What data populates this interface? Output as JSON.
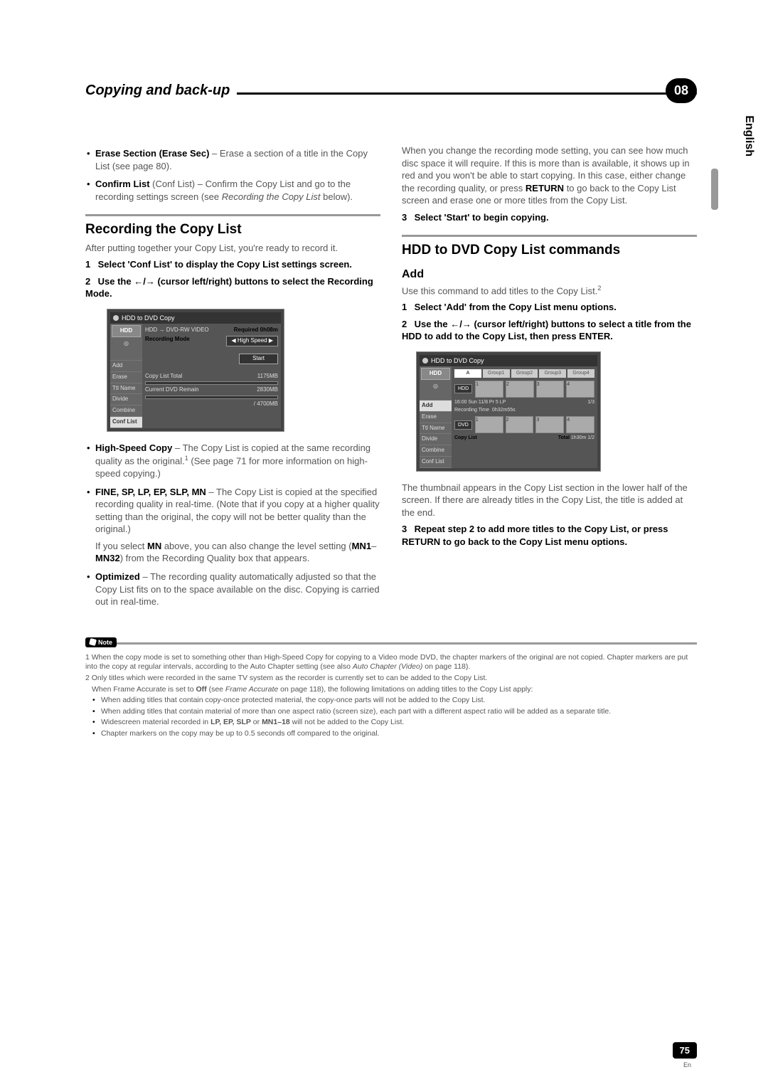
{
  "header": {
    "title": "Copying and back-up",
    "chapter": "08"
  },
  "language": "English",
  "left": {
    "b1_strong": "Erase Section (Erase Sec)",
    "b1_rest": " – Erase a section of a title in the Copy List (see page 80).",
    "b2_strong": "Confirm List",
    "b2_paren": " (Conf List)",
    "b2_rest": " – Confirm the Copy List and go to the recording settings screen (see ",
    "b2_italic": "Recording the Copy List",
    "b2_tail": " below).",
    "h1": "Recording the Copy List",
    "intro": "After putting together your Copy List, you're ready to record it.",
    "step1": "Select 'Conf List' to display the Copy List settings screen.",
    "step2_a": "Use the ",
    "step2_arrows": "←/→",
    "step2_b": " (cursor left/right) buttons to select the Recording Mode.",
    "ss1": {
      "title": "HDD to DVD Copy",
      "hdd_label": "HDD",
      "dest": "HDD → DVD-RW  VIDEO",
      "required": "Required 0h08m",
      "rec_mode_lbl": "Recording Mode",
      "rec_mode_val": "High Speed",
      "start": "Start",
      "copy_total_lbl": "Copy List Total",
      "copy_total_val": "1175MB",
      "remain_lbl": "Current DVD Remain",
      "remain_val": "2830MB",
      "capacity": "/ 4700MB",
      "side": [
        "Add",
        "Erase",
        "Ttl Name",
        "Divide",
        "Combine",
        "Conf List"
      ],
      "side_sel_idx": 5
    },
    "hs_strong": "High-Speed Copy",
    "hs_rest": " – The Copy List is copied at the same recording quality as the original.",
    "hs_fn": "1",
    "hs_tail": " (See page 71 for more information on high-speed copying.)",
    "modes_strong": "FINE, SP, LP, EP, SLP, MN",
    "modes_rest": " – The Copy List is copied at the specified recording quality in real-time. (Note that if you copy at a higher quality setting than the original, the copy will not be better quality than the original.)",
    "mn_a": "If you select ",
    "mn_b": "MN",
    "mn_c": " above, you can also change the level setting (",
    "mn_d": "MN1",
    "mn_e": "–",
    "mn_f": "MN32",
    "mn_g": ") from the Recording Quality box that appears.",
    "opt_strong": "Optimized",
    "opt_rest": " – The recording quality automatically adjusted so that the Copy List fits on to the space available on the disc. Copying is carried out in real-time."
  },
  "right": {
    "p1_a": "When you change the recording mode setting, you can see how much disc space it will require. If this is more than is available, it shows up in red and you won't be able to start copying. In this case, either change the recording quality, or press ",
    "p1_b": "RETURN",
    "p1_c": " to go back to the Copy List screen and erase one or more titles from the Copy List.",
    "step3": "Select 'Start' to begin copying.",
    "h2": "HDD to DVD Copy List commands",
    "sub_add": "Add",
    "add_intro": "Use this command to add titles to the Copy List.",
    "add_fn": "2",
    "add_step1": "Select 'Add' from the Copy List menu options.",
    "add_step2_a": "Use the ",
    "add_step2_arrows": "←/→",
    "add_step2_b": " (cursor left/right) buttons to select a title from the HDD to add to the Copy List, then press ENTER.",
    "ss2": {
      "title": "HDD to DVD Copy",
      "groups": [
        "A",
        "Group1",
        "Group2",
        "Group3",
        "Group4"
      ],
      "hdd": "HDD",
      "dvd": "DVD",
      "info_line": "16:00 Sun  11/8    Pr 5  LP",
      "rec_time_lbl": "Recording Time",
      "rec_time_val": "0h32m55s",
      "page_top": "1/3",
      "copy_list_lbl": "Copy List",
      "total_lbl": "Total",
      "total_val": "1h30m",
      "page_bot": "1/2",
      "side": [
        "Add",
        "Erase",
        "Ttl Name",
        "Divide",
        "Combine",
        "Conf List"
      ],
      "side_sel_idx": 0
    },
    "thumb_p": "The thumbnail appears in the Copy List section in the lower half of the screen. If there are already titles in the Copy List, the title is added at the end.",
    "step3b": "Repeat step 2 to add more titles to the Copy List, or press RETURN to go back to the Copy List menu options."
  },
  "notes": {
    "label": "Note",
    "n1_a": "1 When the copy mode is set to something other than High-Speed Copy for copying to a Video mode DVD, the chapter markers of the original are not copied. Chapter markers are put into the copy at regular intervals, according to the Auto Chapter setting (see also ",
    "n1_b": "Auto Chapter (Video)",
    "n1_c": " on page 118).",
    "n2": "2 Only titles which were recorded in the same TV system as the recorder is currently set to can be added to the Copy List.",
    "n2b_a": "When Frame Accurate is set to ",
    "n2b_b": "Off",
    "n2b_c": " (see ",
    "n2b_d": "Frame Accurate",
    "n2b_e": " on page 118), the following limitations on adding titles to the Copy List apply:",
    "bul1": "When adding titles that contain copy-once protected material, the copy-once parts will not be added to the Copy List.",
    "bul2": "When adding titles that contain material of more than one aspect ratio (screen size), each part with a different aspect ratio will be added as a separate title.",
    "bul3_a": "Widescreen material recorded in ",
    "bul3_b": "LP, EP, SLP",
    "bul3_c": " or ",
    "bul3_d": "MN1–18",
    "bul3_e": " will not be added to the Copy List.",
    "bul4": "Chapter markers on the copy may be up to 0.5 seconds off compared to the original."
  },
  "page_num": "75",
  "page_lang": "En"
}
